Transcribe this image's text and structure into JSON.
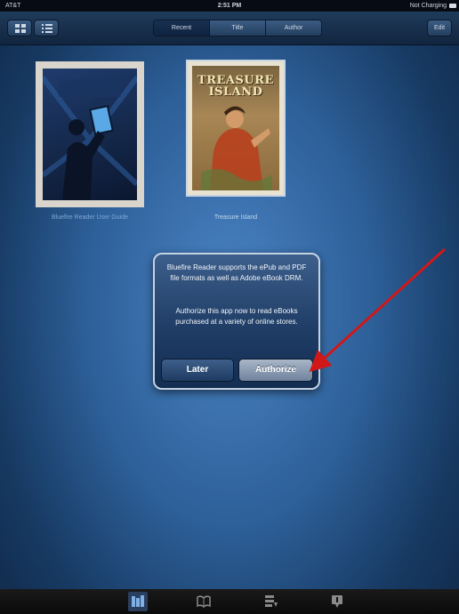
{
  "status_bar": {
    "carrier": "AT&T",
    "time": "2:51 PM",
    "battery": "Not Charging"
  },
  "toolbar": {
    "sort_tabs": [
      {
        "label": "Recent",
        "active": true
      },
      {
        "label": "Title",
        "active": false
      },
      {
        "label": "Author",
        "active": false
      }
    ],
    "edit_label": "Edit",
    "grid_icon": "grid-view-icon",
    "list_icon": "list-view-icon"
  },
  "books": [
    {
      "label": "Bluefire Reader User Guide"
    },
    {
      "label": "Treasure Island",
      "cover_title": "TREASURE ISLAND"
    }
  ],
  "alert": {
    "message_1": "Bluefire Reader supports the ePub and PDF file formats as well as Adobe eBook DRM.",
    "message_2": "Authorize this app now to read eBooks purchased at a variety of online stores.",
    "later_label": "Later",
    "authorize_label": "Authorize"
  },
  "annotation": {
    "arrow_color": "#d01818"
  },
  "tab_bar": {
    "tabs": [
      {
        "icon": "library-icon",
        "active": true
      },
      {
        "icon": "open-book-icon",
        "active": false
      },
      {
        "icon": "downloads-icon",
        "active": false
      },
      {
        "icon": "info-icon",
        "active": false
      }
    ]
  },
  "colors": {
    "accent": "#2d5f98",
    "toolbar": "#203b5b",
    "alert_border": "#c4d2e3"
  }
}
